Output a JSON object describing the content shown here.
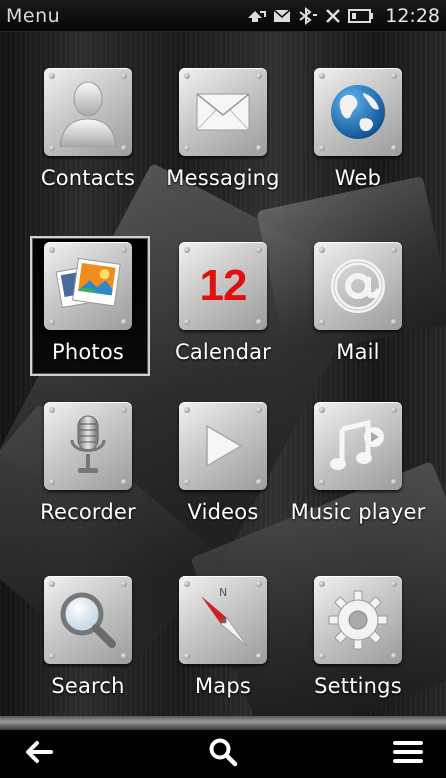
{
  "status_bar": {
    "title": "Menu",
    "time": "12:28",
    "icons": [
      "data-transfer-icon",
      "message-icon",
      "bluetooth-icon",
      "no-signal-icon",
      "battery-icon"
    ]
  },
  "apps": [
    {
      "label": "Contacts",
      "icon": "contacts-icon"
    },
    {
      "label": "Messaging",
      "icon": "envelope-icon"
    },
    {
      "label": "Web",
      "icon": "globe-icon"
    },
    {
      "label": "Photos",
      "icon": "photos-icon",
      "selected": true
    },
    {
      "label": "Calendar",
      "icon": "calendar-icon",
      "calendar_day": "12"
    },
    {
      "label": "Mail",
      "icon": "at-sign-icon"
    },
    {
      "label": "Recorder",
      "icon": "microphone-icon"
    },
    {
      "label": "Videos",
      "icon": "play-icon"
    },
    {
      "label": "Music player",
      "icon": "music-note-icon"
    },
    {
      "label": "Search",
      "icon": "magnifier-icon"
    },
    {
      "label": "Maps",
      "icon": "compass-icon",
      "compass_letter": "N"
    },
    {
      "label": "Settings",
      "icon": "gear-icon"
    }
  ],
  "navbar": {
    "icons": [
      "back-arrow-icon",
      "search-icon",
      "options-menu-icon"
    ]
  },
  "colors": {
    "calendar_red": "#e01010",
    "globe_blue": "#1c6fb8",
    "selection_border": "#d0d0d0"
  }
}
